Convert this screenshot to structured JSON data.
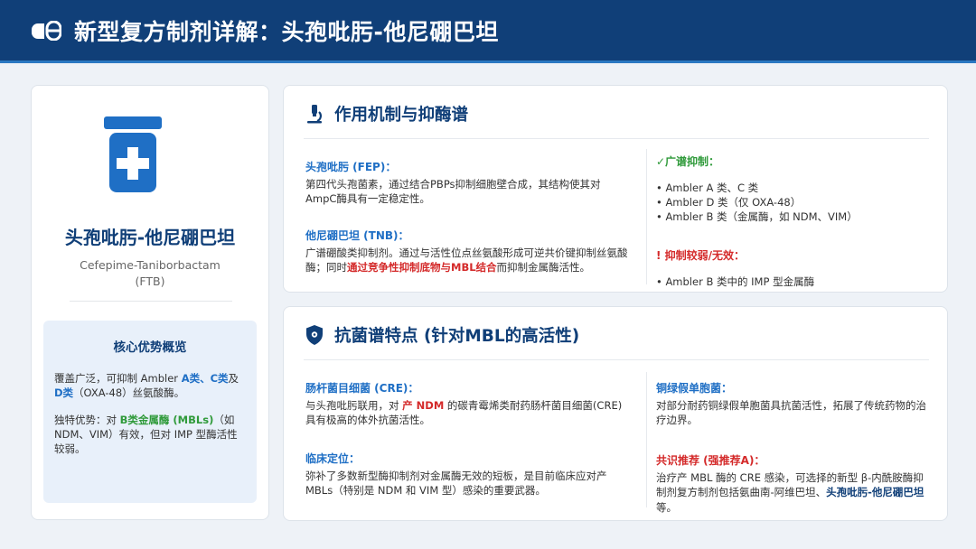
{
  "header": {
    "title": "新型复方制剂详解：头孢吡肟-他尼硼巴坦",
    "logo_icon": "pill-icon"
  },
  "left": {
    "drug_icon": "medicine-bottle-icon",
    "name": "头孢吡肟-他尼硼巴坦",
    "name_en": "Cefepime-Taniborbactam",
    "abbr": "(FTB)",
    "advantage": {
      "title": "核心优势概览",
      "p1": [
        "覆盖广泛，可抑制 Ambler ",
        "A类",
        "、",
        "C类",
        "及",
        "D类",
        "（OXA-48）丝氨酸酶。"
      ],
      "p2": [
        "独特优势：对 ",
        "B类金属酶 (MBLs)",
        "（如 NDM、VIM）有效，但对 IMP 型酶活性较弱。"
      ]
    }
  },
  "mechanism": {
    "icon": "microscope-icon",
    "title": "作用机制与抑酶谱",
    "fep_title": "头孢吡肟 (FEP)：",
    "fep_text": "第四代头孢菌素，通过结合PBPs抑制细胞壁合成，其结构使其对AmpC酶具有一定稳定性。",
    "tnb_title": "他尼硼巴坦 (TNB)：",
    "tnb_text": [
      "广谱硼酸类抑制剂。通过与活性位点丝氨酸形成可逆共价键抑制丝氨酸酶；同时",
      "通过竞争性抑制底物与MBL结合",
      "而抑制金属酶活性。"
    ],
    "broad_title": "✓广谱抑制：",
    "broad_items": [
      "• Ambler A 类、C 类",
      "• Ambler D 类（仅 OXA-48）",
      "• Ambler B 类（金属酶，如 NDM、VIM）"
    ],
    "weak_title": "! 抑制较弱/无效：",
    "weak_items": [
      "• Ambler B 类中的 IMP 型金属酶"
    ]
  },
  "spectrum": {
    "icon": "shield-icon",
    "title": "抗菌谱特点 (针对MBL的高活性)",
    "cre_title": "肠杆菌目细菌 (CRE)：",
    "cre_text": [
      "与头孢吡肟联用，对 ",
      "产 NDM",
      " 的碳青霉烯类耐药肠杆菌目细菌(CRE)具有极高的体外抗菌活性。"
    ],
    "clinical_title": "临床定位：",
    "clinical_text": "弥补了多数新型酶抑制剂对金属酶无效的短板，是目前临床应对产 MBLs（特别是 NDM 和 VIM 型）感染的重要武器。",
    "pa_title": "铜绿假单胞菌：",
    "pa_text": "对部分耐药铜绿假单胞菌具抗菌活性，拓展了传统药物的治疗边界。",
    "consensus_title": "共识推荐 (强推荐A)：",
    "consensus_text": [
      "治疗产 MBL 酶的 CRE 感染，可选择的新型 β-内酰胺酶抑制剂复方制剂包括氨曲南-阿维巴坦、",
      "头孢吡肟-他尼硼巴坦",
      "等。"
    ]
  },
  "colors": {
    "header_bg": "#103f78",
    "accent_blue": "#1f6fc5",
    "warn_red": "#d42a2a",
    "ok_green": "#2f9a3a"
  }
}
